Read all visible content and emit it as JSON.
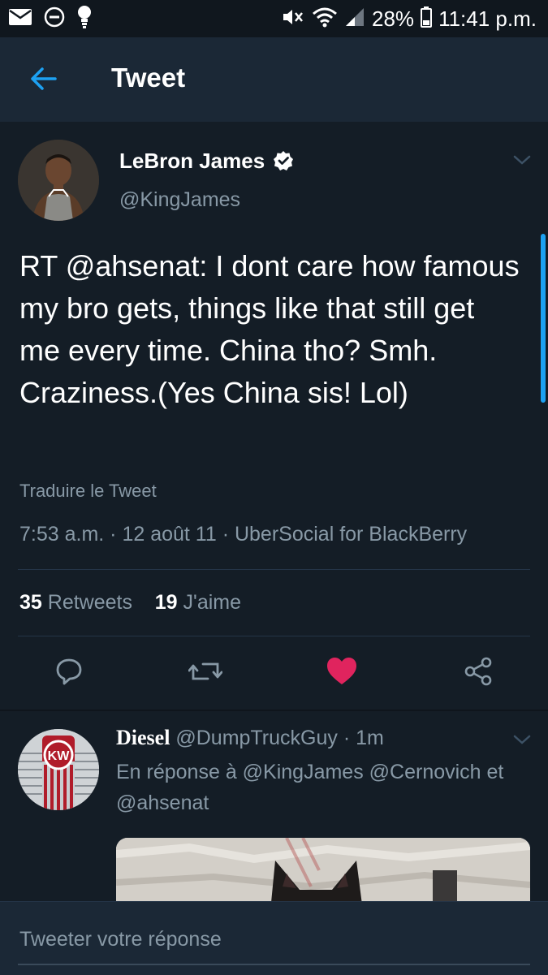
{
  "status_bar": {
    "battery": "28%",
    "time": "11:41 p.m."
  },
  "header": {
    "title": "Tweet"
  },
  "tweet": {
    "author_name": "LeBron James",
    "author_handle": "@KingJames",
    "text_prefix": "RT ",
    "text_mention": "@ahsenat",
    "text_body": ": I dont care how famous my bro gets, things like that still get me every time. China tho? Smh. Craziness.(Yes China sis! Lol)",
    "translate_label": "Traduire le Tweet",
    "meta": "7:53 a.m. · 12 août 11 · UberSocial for BlackBerry",
    "retweet_count": "35",
    "retweet_label": "Retweets",
    "like_count": "19",
    "like_label": "J'aime",
    "liked": true
  },
  "reply": {
    "author_name": "Diesel",
    "author_handle": "@DumpTruckGuy",
    "time": "· 1m",
    "in_reply_to": "En réponse à @KingJames @Cernovich et @ahsenat"
  },
  "composer": {
    "placeholder": "Tweeter votre réponse"
  },
  "colors": {
    "background": "#141d26",
    "header": "#1b2836",
    "secondary_text": "#8899a6",
    "accent": "#1da1f2",
    "like": "#e0245e"
  },
  "icons": {
    "back": "arrow-left-icon",
    "verified": "verified-badge-icon",
    "reply": "reply-icon",
    "retweet": "retweet-icon",
    "like": "heart-icon",
    "share": "share-icon"
  }
}
